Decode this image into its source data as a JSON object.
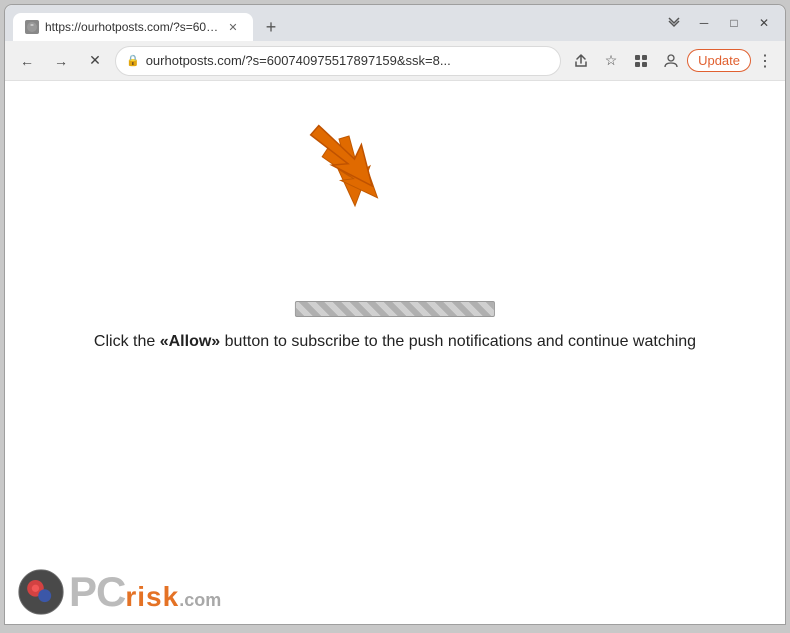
{
  "browser": {
    "window_controls": {
      "minimize_label": "─",
      "maximize_label": "□",
      "close_label": "✕",
      "expand_label": "⌄⌄"
    },
    "tab": {
      "title": "https://ourhotposts.com/?s=600...",
      "favicon": "🔒"
    },
    "new_tab_label": "+",
    "address_bar": {
      "url": "ourhotposts.com/?s=600740975517897159&ssk=8...",
      "lock_icon": "🔒"
    },
    "nav": {
      "back_label": "←",
      "forward_label": "→",
      "reload_label": "✕",
      "share_label": "⬆",
      "bookmark_label": "☆",
      "extensions_label": "⬛",
      "profile_label": "👤",
      "update_label": "Update",
      "menu_label": "⋮"
    }
  },
  "page": {
    "instruction_text": "Click the «Allow» button to subscribe to the push notifications and continue watching",
    "allow_word": "«Allow»",
    "progress_bar_label": "loading-progress"
  },
  "watermark": {
    "pc_text": "PC",
    "risk_text": "risk",
    "dotcom_text": ".com"
  }
}
